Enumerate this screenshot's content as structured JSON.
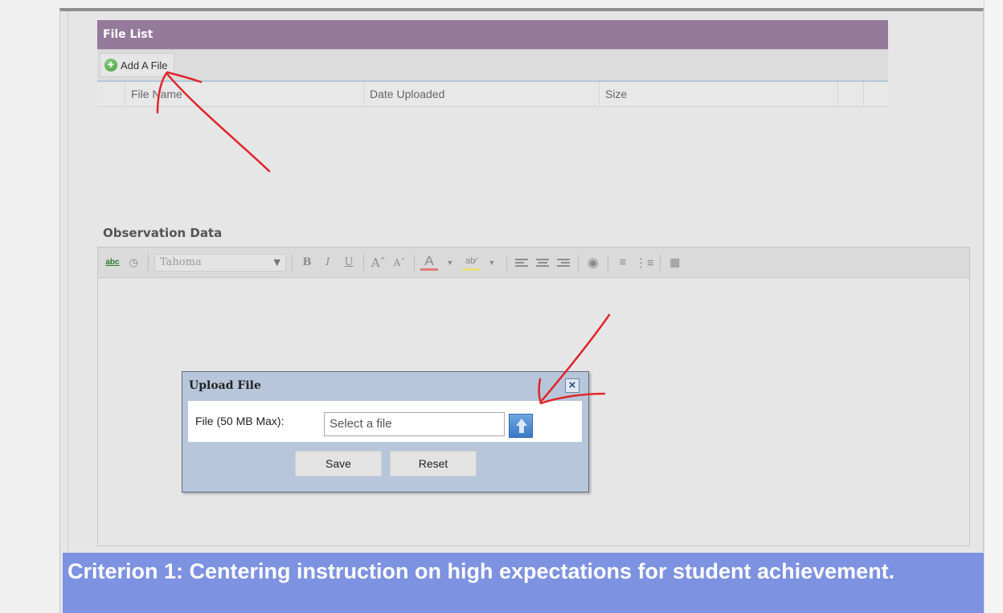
{
  "file_list": {
    "title": "File List",
    "add_file_label": "Add A File",
    "columns": [
      "File Name",
      "Date Uploaded",
      "Size"
    ]
  },
  "observation": {
    "title": "Observation Data",
    "toolbar": {
      "font": "Tahoma",
      "bold": "B",
      "italic": "I",
      "underline": "U"
    }
  },
  "upload_dialog": {
    "title": "Upload File",
    "close_label": "×",
    "file_label": "File (50 MB Max):",
    "file_placeholder": "Select a file",
    "save_label": "Save",
    "reset_label": "Reset"
  },
  "criterion": {
    "text": "Criterion 1: Centering instruction on high expectations for student achievement."
  },
  "colors": {
    "file_list_header": "#957a9c",
    "criterion_banner": "#7d92e0",
    "dialog_bg": "#b7c6da",
    "annotation": "#e0262c"
  }
}
